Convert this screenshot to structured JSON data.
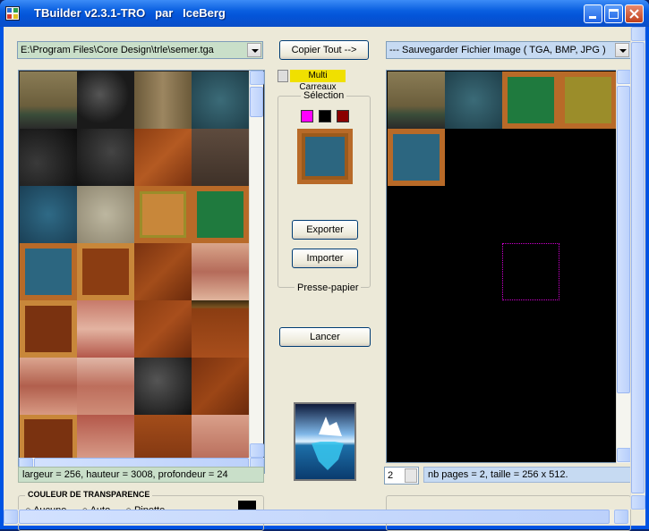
{
  "window": {
    "title": "TBuilder v2.3.1-TRO   par   IceBerg",
    "controls": {
      "minimize": "minimize-icon",
      "maximize": "maximize-icon",
      "close": "close-icon"
    }
  },
  "left": {
    "file_path": "E:\\Program Files\\Core Design\\trle\\semer.tga",
    "status": "largeur = 256, hauteur = 3008, profondeur = 24"
  },
  "transparency": {
    "title": "COULEUR DE TRANSPARENCE",
    "options": [
      "Aucune",
      "Auto",
      "Pipette"
    ],
    "selected": "Aucune",
    "color": "#000000"
  },
  "center": {
    "copy_all_label": "Copier Tout -->",
    "multi_tiles_label": "Multi Carreaux",
    "selection_title": "Sélection",
    "swatches": [
      "#ff00ff",
      "#000000",
      "#8b0000"
    ],
    "export_label": "Exporter",
    "import_label": "Importer",
    "clipboard_title": "Presse-papier",
    "launch_label": "Lancer"
  },
  "right": {
    "save_combo": "--- Sauvegarder Fichier Image ( TGA, BMP, JPG )",
    "page_value": "2",
    "status": "nb pages = 2, taille = 256 x 512."
  },
  "colors": {
    "titlebar": "#0054e3",
    "face": "#ece9d8",
    "status_green": "#c9dfc9",
    "status_blue": "#c6daf2",
    "multi_tiles_bg": "#f0e000"
  }
}
